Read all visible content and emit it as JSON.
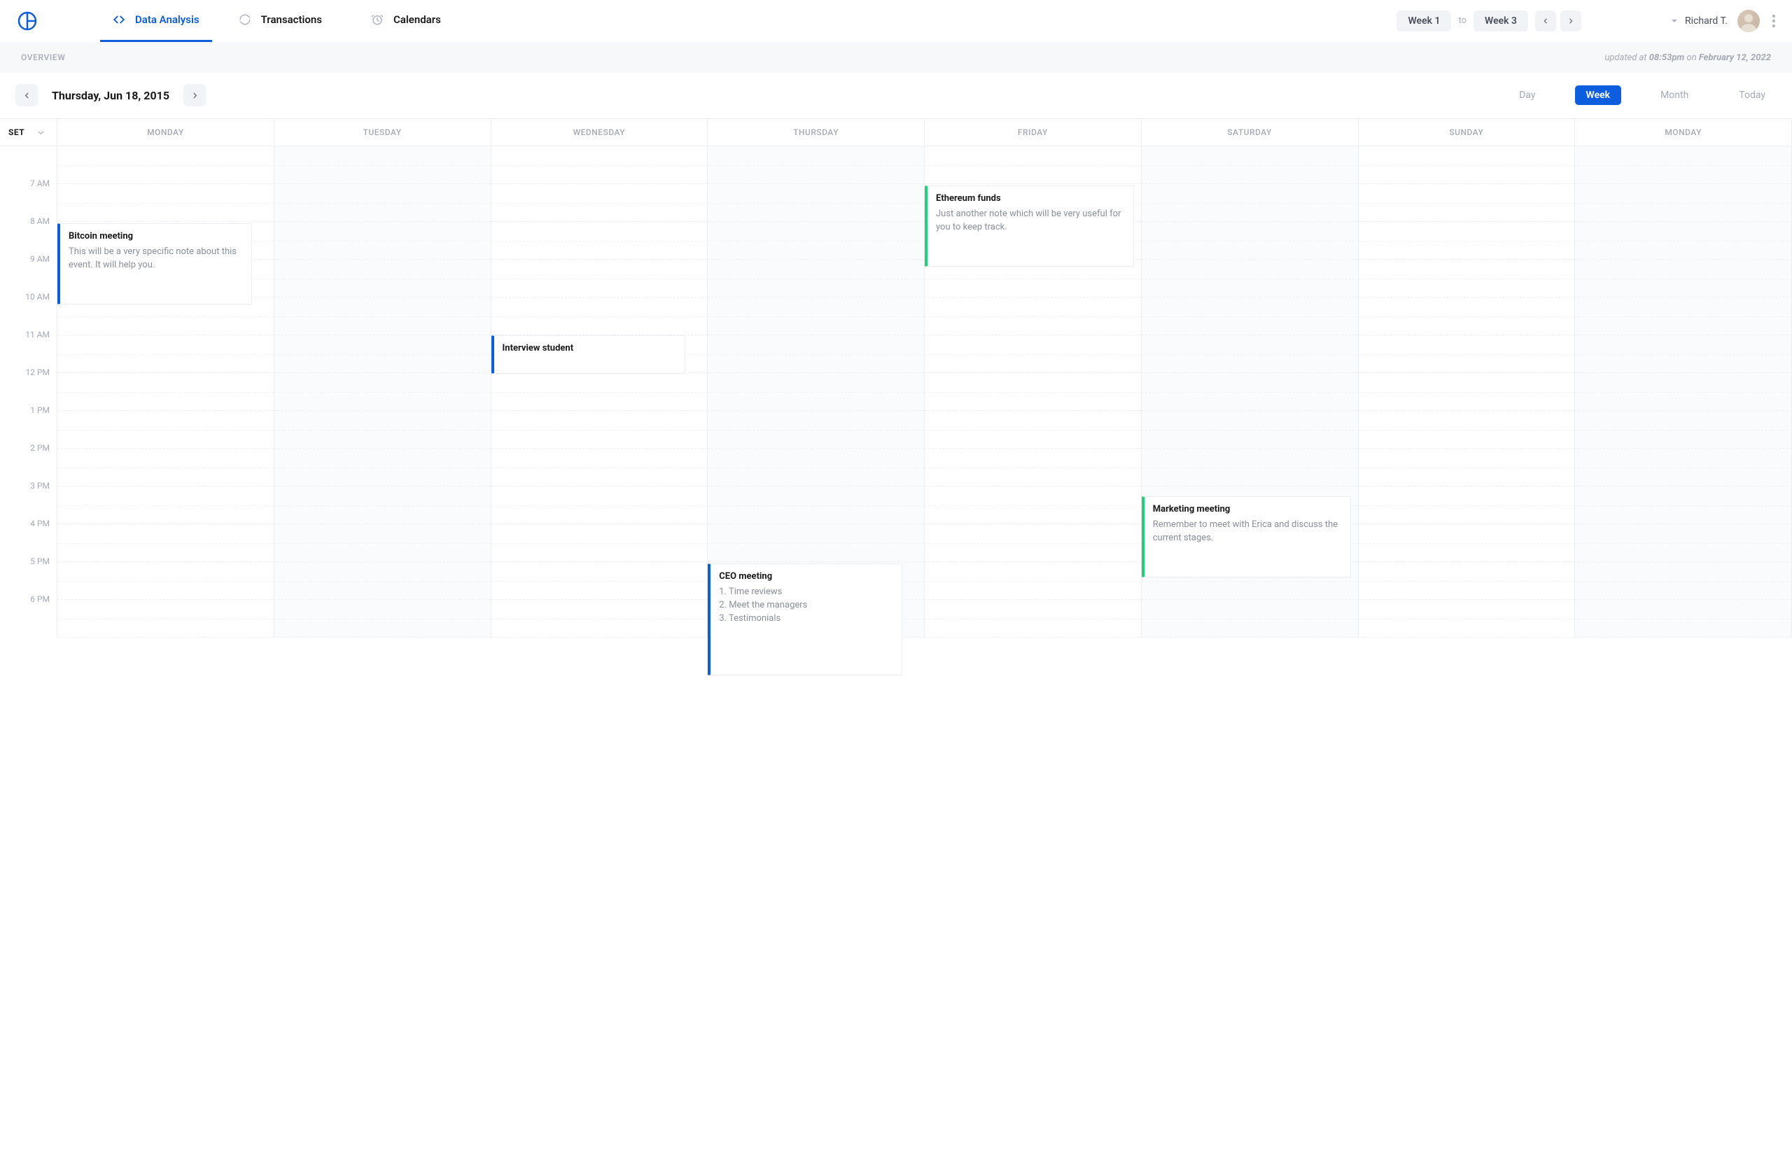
{
  "nav": {
    "tabs": [
      {
        "label": "Data Analysis"
      },
      {
        "label": "Transactions"
      },
      {
        "label": "Calendars"
      }
    ]
  },
  "week_selector": {
    "from": "Week 1",
    "to_label": "to",
    "to": "Week 3"
  },
  "user": {
    "name": "Richard T."
  },
  "subheader": {
    "overview": "OVERVIEW",
    "updated_prefix": "updated at ",
    "time": "08:53pm",
    "on": " on ",
    "date": "February 12, 2022"
  },
  "controls": {
    "date": "Thursday, Jun 18, 2015",
    "views": {
      "day": "Day",
      "week": "Week",
      "month": "Month",
      "today": "Today"
    }
  },
  "calendar": {
    "set_label": "SET",
    "days": [
      "MONDAY",
      "TUESDAY",
      "WEDNESDAY",
      "THURSDAY",
      "FRIDAY",
      "SATURDAY",
      "SUNDAY",
      "MONDAY"
    ],
    "times": [
      "7 AM",
      "8 AM",
      "9 AM",
      "10 AM",
      "11 AM",
      "12 PM",
      "1 PM",
      "2 PM",
      "3 PM",
      "4 PM",
      "5 PM",
      "6 PM"
    ]
  },
  "events": {
    "e1": {
      "title": "Bitcoin meeting",
      "desc": "This will be a very specific note about this event. It will help you."
    },
    "e2": {
      "title": "Interview student",
      "desc": ""
    },
    "e3": {
      "title": "CEO meeting",
      "desc": "1. Time reviews\n2. Meet the managers\n3. Testimonials"
    },
    "e4": {
      "title": "Ethereum funds",
      "desc": "Just another note which will be very useful for you to keep track."
    },
    "e5": {
      "title": "Marketing meeting",
      "desc": "Remember to meet with Erica and discuss the current stages."
    }
  }
}
